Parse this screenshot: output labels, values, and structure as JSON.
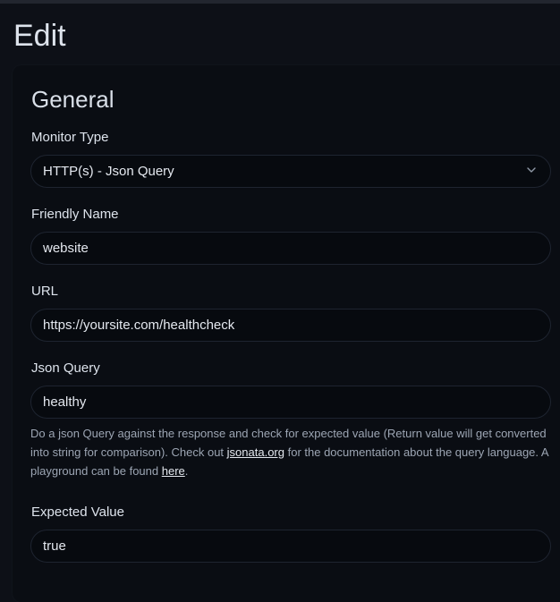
{
  "page": {
    "title": "Edit"
  },
  "general": {
    "title": "General",
    "monitor_type": {
      "label": "Monitor Type",
      "value": "HTTP(s) - Json Query"
    },
    "friendly_name": {
      "label": "Friendly Name",
      "value": "website"
    },
    "url": {
      "label": "URL",
      "value": "https://yoursite.com/healthcheck"
    },
    "json_query": {
      "label": "Json Query",
      "value": "healthy",
      "help": {
        "text_1": "Do a json Query against the response and check for expected value (Return value will get converted into string for comparison). Check out ",
        "link_1": "jsonata.org",
        "text_2": " for the documentation about the query language. A playground can be found ",
        "link_2": "here",
        "text_3": "."
      }
    },
    "expected_value": {
      "label": "Expected Value",
      "value": "true"
    }
  },
  "icons": {
    "chevron": "chevron-down-icon"
  },
  "colors": {
    "background": "#0d1017",
    "card": "#0a0d13",
    "field_border": "#1e2430",
    "text": "#dde3ec",
    "help_text": "#9ca5b3"
  }
}
